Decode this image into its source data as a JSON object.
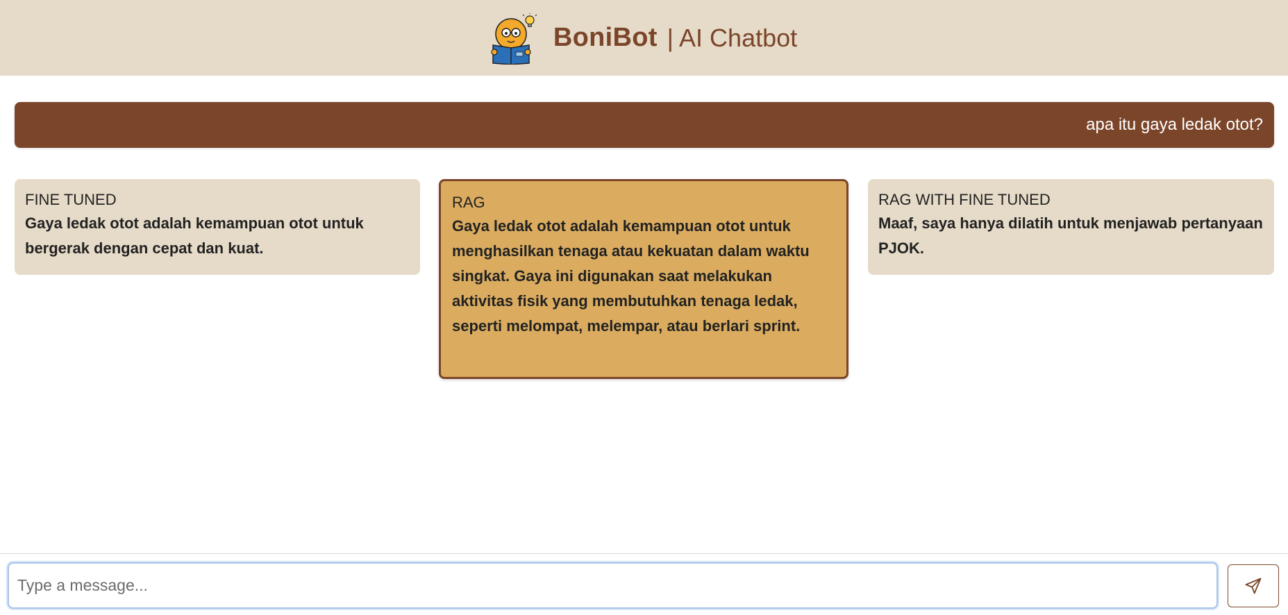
{
  "header": {
    "brand_name": "BoniBot",
    "subtitle": "| AI Chatbot",
    "logo_icon": "bonibot-reading-mascot-icon"
  },
  "conversation": {
    "user_message": "apa itu gaya ledak otot?",
    "responses": [
      {
        "title": "FINE TUNED",
        "text": "Gaya ledak otot adalah kemampuan otot untuk bergerak dengan cepat dan kuat."
      },
      {
        "title": "RAG",
        "text": "Gaya ledak otot adalah kemampuan otot untuk menghasilkan tenaga atau kekuatan dalam waktu singkat. Gaya ini digunakan saat melakukan aktivitas fisik yang membutuhkan tenaga ledak, seperti melompat, melempar, atau berlari sprint.",
        "highlighted": true
      },
      {
        "title": "RAG WITH FINE TUNED",
        "text": "Maaf, saya hanya dilatih untuk menjawab pertanyaan PJOK."
      }
    ]
  },
  "composer": {
    "placeholder": "Type a message...",
    "value": "",
    "send_icon": "send-icon"
  },
  "colors": {
    "header_bg": "#e6dbc8",
    "brand": "#7b452a",
    "card_bg": "#e6dbc8",
    "highlight_bg": "#dbac5f"
  }
}
